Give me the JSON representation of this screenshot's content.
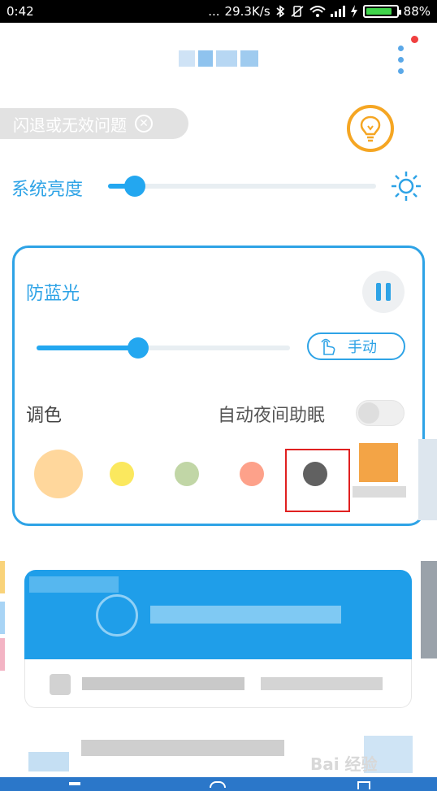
{
  "status_bar": {
    "time": "0:42",
    "signal_dots": "...",
    "speed": "29.3K/s",
    "battery_percent": "88%",
    "battery_level": 0.88
  },
  "feedback_chip": {
    "label": "闪退或无效问题",
    "close_glyph": "⊗"
  },
  "system_brightness": {
    "label": "系统亮度",
    "value_fraction": 0.1
  },
  "blue_light": {
    "title": "防蓝光",
    "intensity_fraction": 0.4,
    "manual_label": "手动",
    "tone_label": "调色",
    "auto_night_label": "自动夜间助眠",
    "auto_night_enabled": false,
    "swatches": [
      {
        "name": "peach",
        "color": "#ffd79c",
        "selected": false
      },
      {
        "name": "yellow",
        "color": "#fbe85e",
        "selected": false
      },
      {
        "name": "green",
        "color": "#c1d6a6",
        "selected": false
      },
      {
        "name": "salmon",
        "color": "#fda18a",
        "selected": false
      },
      {
        "name": "dark-gray",
        "color": "#616161",
        "selected": true
      }
    ]
  },
  "colors": {
    "accent": "#2ea3e6",
    "highlight_box": "#e02020",
    "bulb": "#f5a623"
  },
  "watermark": "Bai 经验"
}
